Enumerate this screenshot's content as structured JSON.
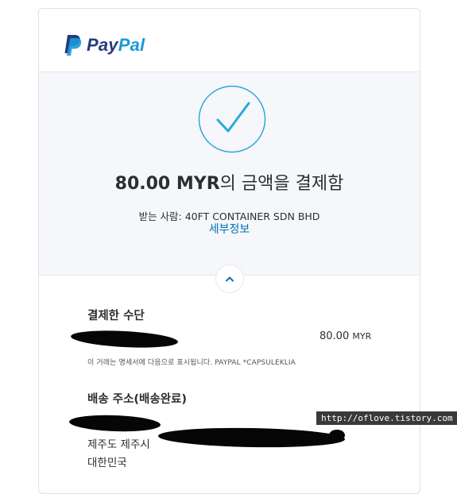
{
  "brand": {
    "pay": "Pay",
    "pal": "Pal",
    "colors": {
      "dark_blue": "#253b80",
      "light_blue": "#179bd7"
    }
  },
  "confirmation": {
    "amount": "80.00 MYR",
    "amount_suffix": "의 금액을 결제함",
    "recipient": "받는 사람: 40FT CONTAINER SDN BHD",
    "details_link": "세부정보",
    "check_icon_color": "#2ba8dd"
  },
  "payment_method": {
    "title": "결제한 수단",
    "amount": "80.00",
    "currency": "MYR",
    "statement_note": "이 거래는 명세서에 다음으로 표시됩니다. PAYPAL *CAPSULEKLIA"
  },
  "shipping": {
    "title": "배송 주소(배송완료)",
    "address_line_partial": "제주도 제주시 ",
    "country": "대한민국"
  },
  "watermark": "http://oflove.tistory.com"
}
